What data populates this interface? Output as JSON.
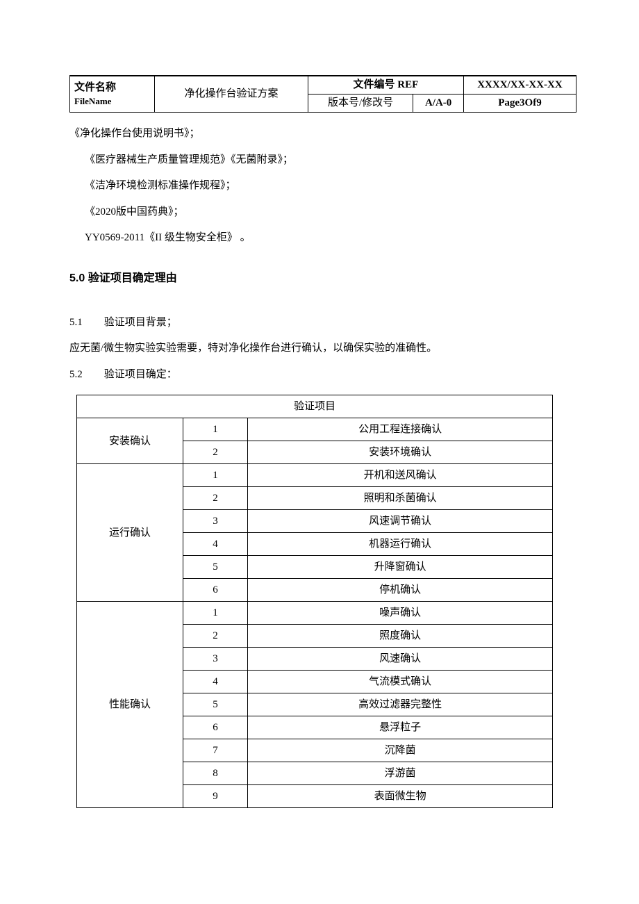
{
  "header": {
    "file_name_label_cn": "文件名称",
    "file_name_label_en": "FileName",
    "title": "净化操作台验证方案",
    "ref_label": "文件编号 REF",
    "ref_value": "XXXX/XX-XX-XX",
    "version_label": "版本号/修改号",
    "version_value": "A/A-0",
    "page_info": "Page3Of9"
  },
  "refs": {
    "r1": "《净化操作台使用说明书》；",
    "r2": "《医疗器械生产质量管理规范》《无菌附录》；",
    "r3": "《洁净环境检测标准操作规程》；",
    "r4": "《2020版中国药典》；",
    "r5": "YY0569-2011《II 级生物安全柜》 。"
  },
  "section5": {
    "heading": "5.0 验证项目确定理由",
    "s51_num": "5.1",
    "s51_title": "验证项目背景；",
    "s51_body": "应无菌/微生物实验实验需要，特对净化操作台进行确认，以确保实验的准确性。",
    "s52_num": "5.2",
    "s52_title": "验证项目确定："
  },
  "proj_table": {
    "caption": "验证项目",
    "groups": [
      {
        "name": "安装确认",
        "items": [
          {
            "n": "1",
            "text": "公用工程连接确认"
          },
          {
            "n": "2",
            "text": "安装环境确认"
          }
        ]
      },
      {
        "name": "运行确认",
        "items": [
          {
            "n": "1",
            "text": "开机和送风确认"
          },
          {
            "n": "2",
            "text": "照明和杀菌确认"
          },
          {
            "n": "3",
            "text": "风速调节确认"
          },
          {
            "n": "4",
            "text": "机器运行确认"
          },
          {
            "n": "5",
            "text": "升降窗确认"
          },
          {
            "n": "6",
            "text": "停机确认"
          }
        ]
      },
      {
        "name": "性能确认",
        "items": [
          {
            "n": "1",
            "text": "噪声确认"
          },
          {
            "n": "2",
            "text": "照度确认"
          },
          {
            "n": "3",
            "text": "风速确认"
          },
          {
            "n": "4",
            "text": "气流模式确认"
          },
          {
            "n": "5",
            "text": "高效过滤器完整性"
          },
          {
            "n": "6",
            "text": "悬浮粒子"
          },
          {
            "n": "7",
            "text": "沉降菌"
          },
          {
            "n": "8",
            "text": "浮游菌"
          },
          {
            "n": "9",
            "text": "表面微生物"
          }
        ]
      }
    ]
  }
}
